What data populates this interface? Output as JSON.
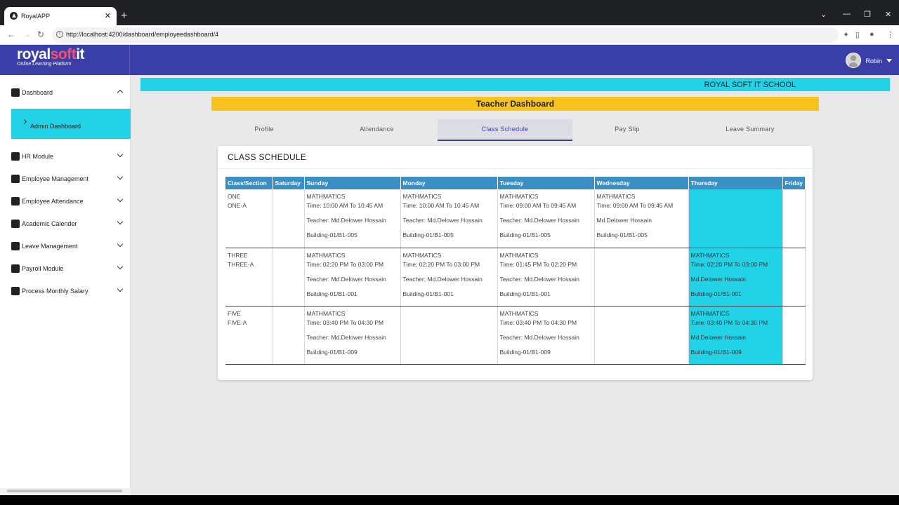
{
  "browser": {
    "tab_title": "RoyalAPP",
    "url": "http://localhost:4200/dashboard/employeedashboard/4"
  },
  "brand": {
    "part1": "royal",
    "part2": "soft",
    "part3": "it",
    "tagline": "Online Learning Platform"
  },
  "user": {
    "name": "Robin"
  },
  "sidebar": {
    "items": [
      {
        "label": "Dashboard",
        "icon": "dashboard-icon"
      },
      {
        "label": "HR Module",
        "icon": "shield-icon"
      },
      {
        "label": "Employee Management",
        "icon": "people-icon"
      },
      {
        "label": "Employee Attendance",
        "icon": "checklist-icon"
      },
      {
        "label": "Academic Calender",
        "icon": "calendar-icon"
      },
      {
        "label": "Leave Management",
        "icon": "gear-icon"
      },
      {
        "label": "Payroll Module",
        "icon": "payroll-icon"
      },
      {
        "label": "Process Monthly Salary",
        "icon": "salary-icon"
      }
    ],
    "sub_active": "Admin Dashboard"
  },
  "banner": {
    "school": "ROYAL SOFT IT SCHOOL"
  },
  "page_title": "Teacher Dashboard",
  "tabs": [
    "Profile",
    "Attendance",
    "Class Schedule",
    "Pay Slip",
    "Leave Summary"
  ],
  "active_tab": "Class Schedule",
  "schedule": {
    "title": "CLASS SCHEDULE",
    "headers": [
      "Class/Section",
      "Saturday",
      "Sunday",
      "Monday",
      "Tuesday",
      "Wednesday",
      "Thursday",
      "Friday"
    ],
    "rows": [
      {
        "class": "ONE",
        "section": "ONE-A",
        "sun": [
          "MATHMATICS",
          "Time: 10:00 AM To 10:45 AM",
          "Teacher: Md.Delower Hossain",
          "Building-01/B1-005"
        ],
        "mon": [
          "MATHMATICS",
          "Time: 10:00 AM To 10:45 AM",
          "Teacher: Md.Delower Hossain",
          "Building-01/B1-005"
        ],
        "tue": [
          "MATHMATICS",
          "Time: 09:00 AM To 09:45 AM",
          "Teacher: Md.Delower Hossain",
          "Building-01/B1-005"
        ],
        "wed": [
          "MATHMATICS",
          "Time: 09:00 AM To 09:45 AM",
          "Md.Delower Hossain",
          "Building-01/B1-005"
        ],
        "thu": [
          "",
          "",
          "",
          ""
        ]
      },
      {
        "class": "THREE",
        "section": "THREE-A",
        "sun": [
          "MATHMATICS",
          "Time: 02:20 PM To 03:00 PM",
          "Teacher: Md.Delower Hossain",
          "Building-01/B1-001"
        ],
        "mon": [
          "MATHMATICS",
          "Time: 02:20 PM To 03:00 PM",
          "Teacher: Md.Delower Hossain",
          "Building-01/B1-001"
        ],
        "tue": [
          "MATHMATICS",
          "Time: 01:45 PM To 02:20 PM",
          "Teacher: Md.Delower Hossain",
          "Building-01/B1-001"
        ],
        "wed": [
          "",
          "",
          "",
          ""
        ],
        "thu": [
          "MATHMATICS",
          "Time: 02:20 PM To 03:00 PM",
          "Md.Delower Hossain",
          "Building-01/B1-001"
        ]
      },
      {
        "class": "FIVE",
        "section": "FIVE-A",
        "sun": [
          "MATHMATICS",
          "Time: 03:40 PM To 04:30 PM",
          "Teacher: Md.Delower Hossain",
          "Building-01/B1-009"
        ],
        "mon": [
          "",
          "",
          "",
          ""
        ],
        "tue": [
          "MATHMATICS",
          "Time: 03:40 PM To 04:30 PM",
          "Teacher: Md.Delower Hossain",
          "Building-01/B1-009"
        ],
        "wed": [
          "",
          "",
          "",
          ""
        ],
        "thu": [
          "MATHMATICS",
          "Time: 03:40 PM To 04:30 PM",
          "Md.Delower Hossain",
          "Building-01/B1-009"
        ]
      }
    ]
  },
  "colors": {
    "primary": "#3a3fa8",
    "cyan": "#22d3e8",
    "yellow": "#f9c21d",
    "table_header": "#3b8fc4"
  }
}
